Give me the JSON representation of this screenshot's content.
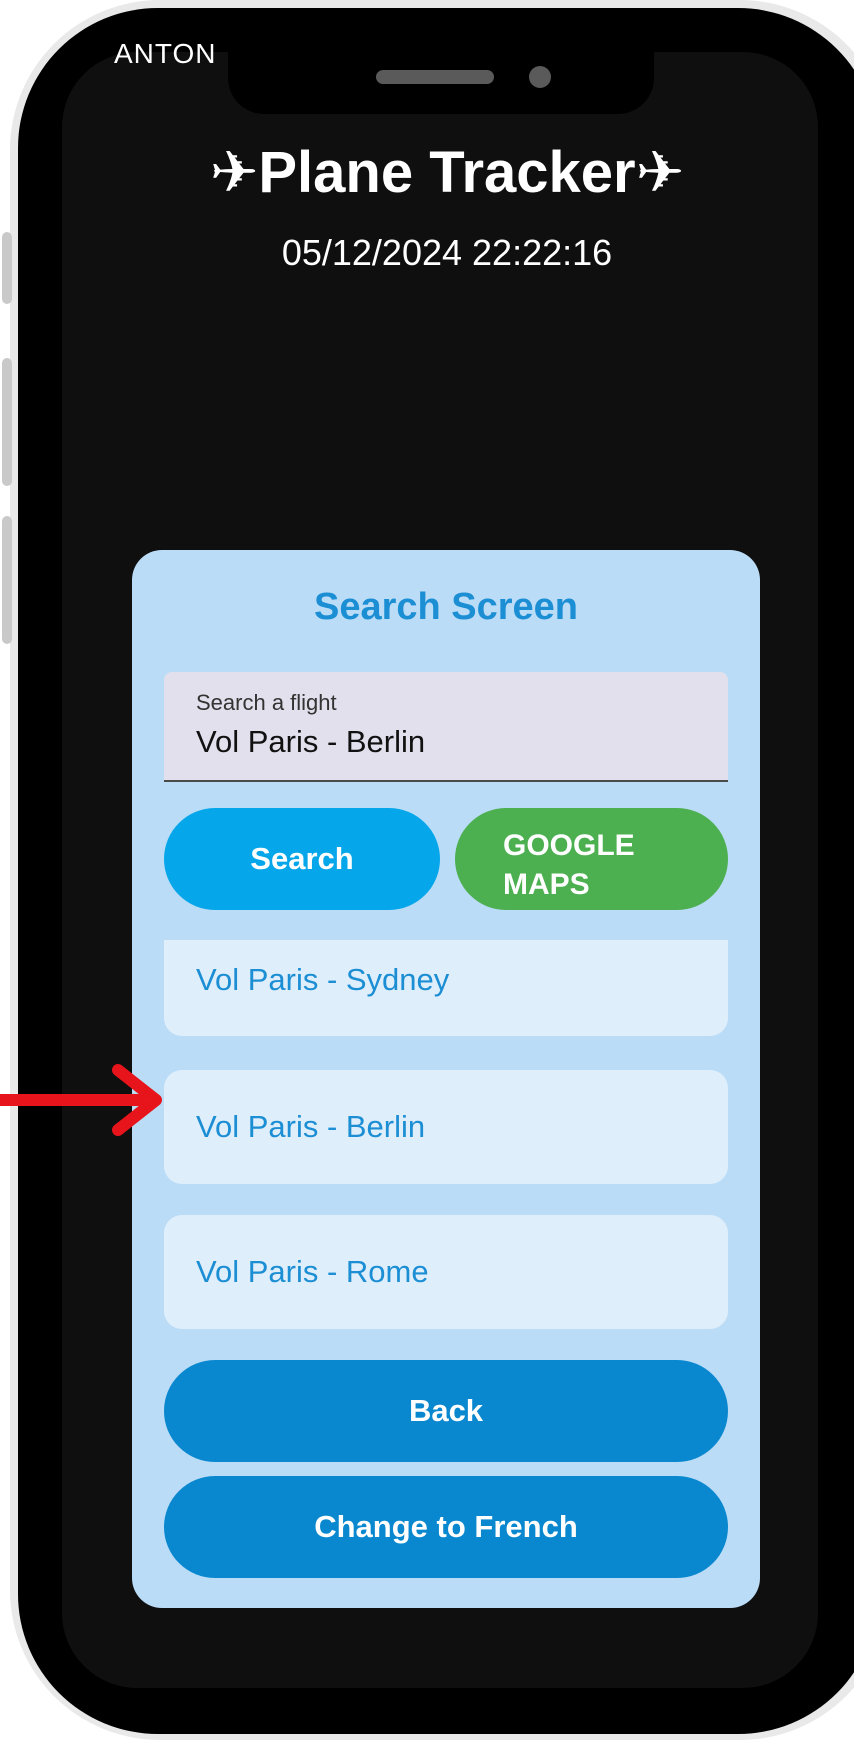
{
  "status_bar": {
    "carrier_text": "ANTON"
  },
  "header": {
    "title": "✈Plane Tracker✈",
    "datetime": "05/12/2024 22:22:16"
  },
  "search_screen": {
    "title": "Search Screen",
    "search_field": {
      "label": "Search a flight",
      "value": "Vol Paris - Berlin"
    },
    "search_button_label": "Search",
    "maps_button_label": "GOOGLE MAPS",
    "results": [
      {
        "label": "Vol Paris - Sydney"
      },
      {
        "label": "Vol Paris - Berlin"
      },
      {
        "label": "Vol Paris - Rome"
      }
    ],
    "back_button_label": "Back",
    "language_button_label": "Change to French"
  },
  "colors": {
    "screen_background": "#0f0f0f",
    "card_background": "#bbdcf7",
    "accent_blue": "#1b8ed4",
    "search_button": "#06a7ea",
    "maps_button": "#4caf50",
    "primary_button": "#0a88cf",
    "annotation_arrow": "#e8141b"
  },
  "icons": {
    "annotation": "red-arrow-right",
    "title_decoration": "airplane"
  }
}
